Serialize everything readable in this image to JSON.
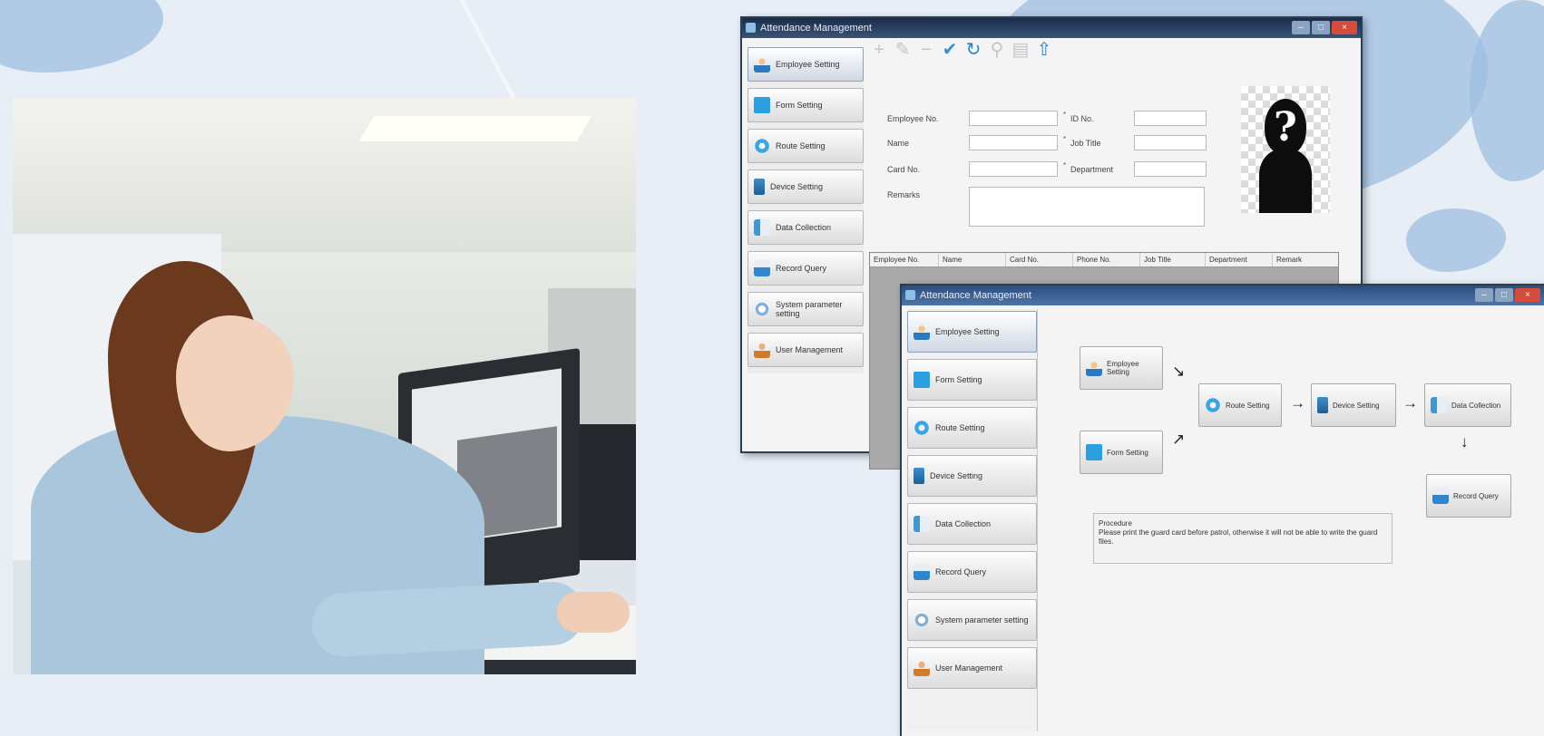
{
  "window_main": {
    "title": "Attendance Management",
    "sidebar": [
      {
        "label": "Employee Setting",
        "icon": "person-icon"
      },
      {
        "label": "Form Setting",
        "icon": "card-icon"
      },
      {
        "label": "Route Setting",
        "icon": "gear-icon"
      },
      {
        "label": "Device Setting",
        "icon": "device-icon"
      },
      {
        "label": "Data Collection",
        "icon": "document-icon"
      },
      {
        "label": "Record Query",
        "icon": "report-icon"
      },
      {
        "label": "System parameter setting",
        "icon": "parameter-icon"
      },
      {
        "label": "User Management",
        "icon": "user-icon"
      }
    ],
    "toolbar": [
      "add-icon",
      "edit-icon",
      "delete-icon",
      "check-icon",
      "refresh-icon",
      "search-icon",
      "print-icon",
      "up-icon"
    ],
    "form": {
      "employee_no_label": "Employee No.",
      "name_label": "Name",
      "card_no_label": "Card No.",
      "remark_label": "Remarks",
      "id_no_label": "ID No.",
      "job_title_label": "Job Title",
      "department_label": "Department"
    },
    "grid_columns": [
      "Employee No.",
      "Name",
      "Card No.",
      "Phone No.",
      "Job Title",
      "Department",
      "Remark"
    ]
  },
  "window_flow": {
    "title": "Attendance Management",
    "sidebar": [
      {
        "label": "Employee Setting",
        "icon": "person-icon"
      },
      {
        "label": "Form Setting",
        "icon": "card-icon"
      },
      {
        "label": "Route Setting",
        "icon": "gear-icon"
      },
      {
        "label": "Device Setting",
        "icon": "device-icon"
      },
      {
        "label": "Data Collection",
        "icon": "document-icon"
      },
      {
        "label": "Record Query",
        "icon": "report-icon"
      },
      {
        "label": "System parameter setting",
        "icon": "parameter-icon"
      },
      {
        "label": "User Management",
        "icon": "user-icon"
      }
    ],
    "flow": {
      "employee": "Employee Setting",
      "form": "Form Setting",
      "route": "Route Setting",
      "device": "Device Setting",
      "data": "Data Collection",
      "record": "Record Query"
    },
    "prompt": {
      "title": "Procedure",
      "body": "Please print the guard card before patrol, otherwise it will not be able to write the guard files."
    }
  },
  "colors": {
    "titlebar": "#1b2c4a",
    "accent": "#2c9fe0",
    "background": "#e7eef6"
  }
}
